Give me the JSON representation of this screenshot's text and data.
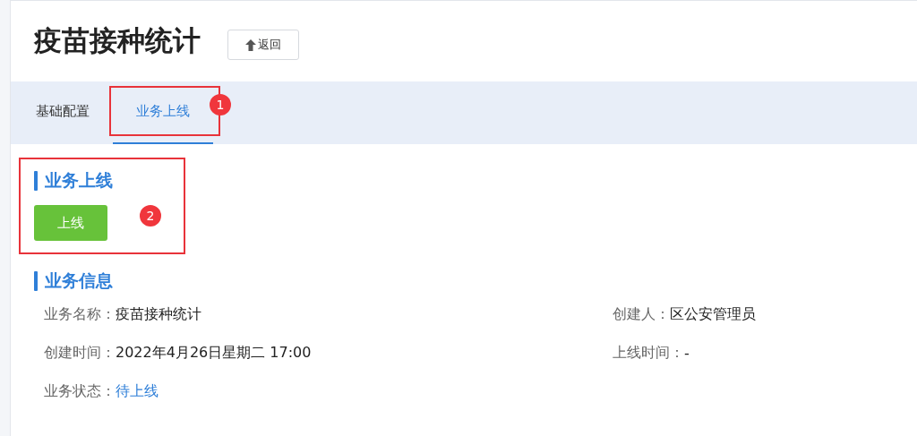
{
  "header": {
    "title": "疫苗接种统计",
    "back_button": "返回"
  },
  "tabs": [
    {
      "label": "基础配置",
      "selected": false
    },
    {
      "label": "业务上线",
      "selected": true,
      "callout": "1"
    }
  ],
  "launch_section": {
    "heading": "业务上线",
    "button": "上线",
    "callout": "2"
  },
  "info_section": {
    "heading": "业务信息",
    "rows": [
      [
        {
          "label": "业务名称：",
          "value": "疫苗接种统计",
          "kind": "plain"
        },
        {
          "label": "创建人：",
          "value": "区公安管理员",
          "kind": "plain"
        }
      ],
      [
        {
          "label": "创建时间：",
          "value": "2022年4月26日星期二 17:00",
          "kind": "plain"
        },
        {
          "label": "上线时间：",
          "value": "-",
          "kind": "plain"
        }
      ],
      [
        {
          "label": "业务状态：",
          "value": "待上线",
          "kind": "status"
        }
      ]
    ]
  }
}
